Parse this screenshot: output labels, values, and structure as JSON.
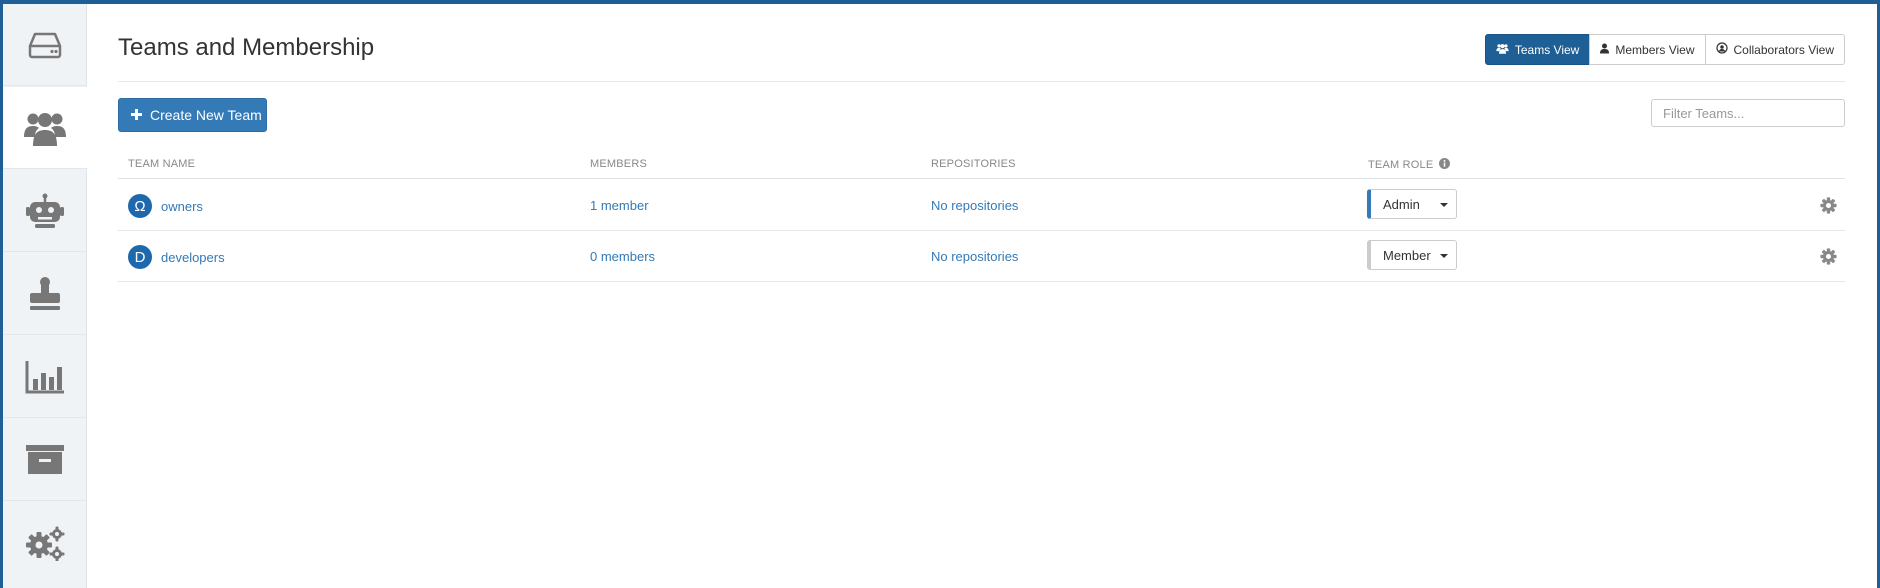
{
  "page": {
    "title": "Teams and Membership"
  },
  "sidebar": {
    "items": [
      {
        "icon": "hard-drive-icon"
      },
      {
        "icon": "users-icon",
        "active": true
      },
      {
        "icon": "robot-icon"
      },
      {
        "icon": "stamp-icon"
      },
      {
        "icon": "bar-chart-icon"
      },
      {
        "icon": "archive-box-icon"
      },
      {
        "icon": "gears-icon"
      }
    ]
  },
  "view_toggle": {
    "teams": "Teams View",
    "members": "Members View",
    "collaborators": "Collaborators View",
    "active": "teams"
  },
  "toolbar": {
    "create_label": "Create New Team",
    "filter_placeholder": "Filter Teams..."
  },
  "table": {
    "headers": {
      "team_name": "TEAM NAME",
      "members": "MEMBERS",
      "repositories": "REPOSITORIES",
      "team_role": "TEAM ROLE"
    },
    "rows": [
      {
        "avatar": "Ω",
        "name": "owners",
        "members": "1 member",
        "repositories": "No repositories",
        "role": "Admin"
      },
      {
        "avatar": "D",
        "name": "developers",
        "members": "0 members",
        "repositories": "No repositories",
        "role": "Member"
      }
    ]
  },
  "colors": {
    "brand": "#1e5f96",
    "link": "#337ab7",
    "avatar": "#1e68ad"
  }
}
